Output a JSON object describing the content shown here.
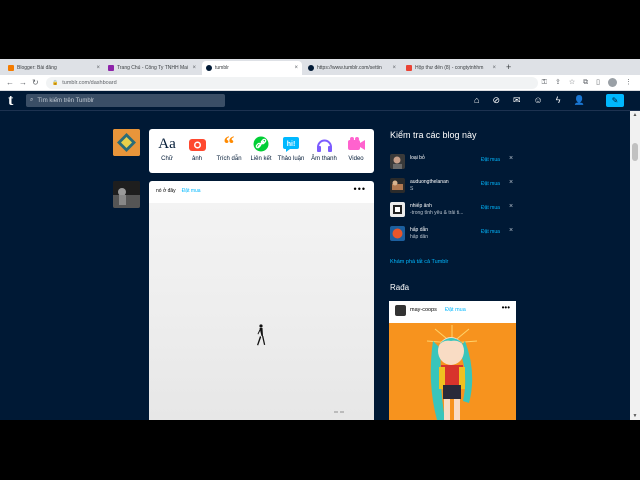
{
  "browser": {
    "tabs": [
      {
        "title": "Blogger: Bài đăng",
        "color": "#f57c00"
      },
      {
        "title": "Trang Chủ - Công Ty TNHH Mai",
        "color": "#8e24aa"
      },
      {
        "title": "tumblr",
        "color": "#001935"
      },
      {
        "title": "https://www.tumblr.com/settin",
        "color": "#001935"
      },
      {
        "title": "Hộp thư đến (8) - congtytnhhm",
        "color": "#ea4335"
      }
    ],
    "url": "tumblr.com/dashboard"
  },
  "tumblr": {
    "logo": "t",
    "search_placeholder": "Tìm kiếm trên Tumblr",
    "nav_icons": [
      "home-icon",
      "explore-icon",
      "inbox-icon",
      "messages-icon",
      "activity-icon",
      "account-icon",
      "compose-icon"
    ]
  },
  "post_types": [
    {
      "label": "Chữ",
      "icon": "text-icon",
      "color": "#001935"
    },
    {
      "label": "ảnh",
      "icon": "camera-icon",
      "color": "#ff492f"
    },
    {
      "label": "Trích dẫn",
      "icon": "quote-icon",
      "color": "#ff8a00"
    },
    {
      "label": "Liên kết",
      "icon": "link-icon",
      "color": "#00cf35"
    },
    {
      "label": "Thảo luận",
      "icon": "chat-icon",
      "color": "#00b8ff"
    },
    {
      "label": "Âm thanh",
      "icon": "audio-icon",
      "color": "#7c5cff"
    },
    {
      "label": "Video",
      "icon": "video-icon",
      "color": "#ff62ce"
    }
  ],
  "post": {
    "blog_name": "nó ở đây",
    "follow_label": "Đặt mua",
    "more": "•••"
  },
  "sidebar": {
    "title": "Kiểm tra các blog này",
    "blogs": [
      {
        "name": "loại bỏ",
        "desc": "",
        "follow": "Đặt mua",
        "close": "×"
      },
      {
        "name": "auduongthelanan",
        "desc": "S",
        "follow": "Đặt mua",
        "close": "×"
      },
      {
        "name": "nhiếp ảnh",
        "desc": "-trong tình yêu & trải ti...",
        "follow": "Đặt mua",
        "close": "×"
      },
      {
        "name": "hấp dẫn",
        "desc": "hấp dẫn",
        "follow": "Đặt mua",
        "close": "×"
      }
    ],
    "explore_label": "Khám phá tất cả Tumblr",
    "radar_title": "Rađa",
    "radar": {
      "name": "may-coops",
      "follow": "Đặt mua",
      "more": "•••"
    }
  }
}
